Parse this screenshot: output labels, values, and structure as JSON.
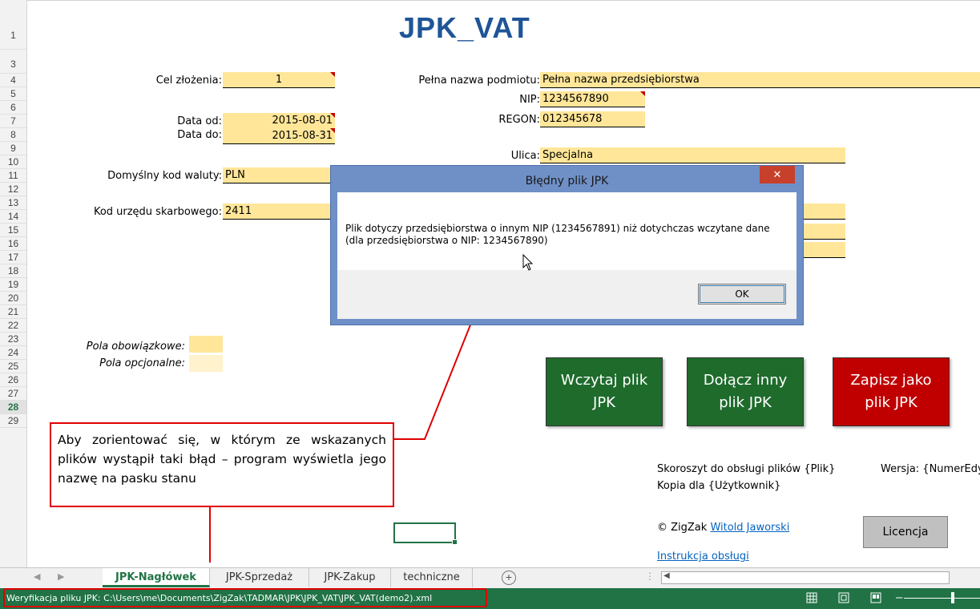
{
  "sheet": {
    "title": "JPK_VAT",
    "row_numbers": [
      "1",
      "3",
      "4",
      "5",
      "6",
      "7",
      "8",
      "9",
      "10",
      "11",
      "12",
      "13",
      "14",
      "15",
      "16",
      "17",
      "18",
      "19",
      "20",
      "21",
      "22",
      "23",
      "24",
      "25",
      "26",
      "27",
      "28",
      "29"
    ],
    "active_row": "28",
    "fields": {
      "cel_label": "Cel złożenia:",
      "cel_value": "1",
      "data_od_label": "Data od:",
      "data_od_value": "2015-08-01",
      "data_do_label": "Data do:",
      "data_do_value": "2015-08-31",
      "waluta_label": "Domyślny kod waluty:",
      "waluta_value": "PLN",
      "urzad_label": "Kod urzędu skarbowego:",
      "urzad_value": "2411",
      "nazwa_label": "Pełna nazwa podmiotu:",
      "nazwa_value": "Pełna nazwa przedsiębiorstwa",
      "nip_label": "NIP:",
      "nip_value": "1234567890",
      "regon_label": "REGON:",
      "regon_value": "012345678",
      "ulica_label": "Ulica:",
      "ulica_value": "Specjalna"
    },
    "legend": {
      "required": "Pola obowiązkowe:",
      "optional": "Pola opcjonalne:",
      "required_color": "#ffe699",
      "optional_color": "#fff2cc"
    },
    "buttons": {
      "load": "Wczytaj plik JPK",
      "append": "Dołącz inny plik JPK",
      "save": "Zapisz jako plik JPK",
      "license": "Licencja"
    },
    "info": {
      "workbook_line": "Skoroszyt do obsługi plików {Plik}",
      "version_line": "Wersja: {NumerEdycj",
      "copy_line": "Kopia dla {Użytkownik}",
      "copyright_prefix": "© ZigZak ",
      "author_link": "Witold Jaworski",
      "manual_link": "Instrukcja obsługi"
    },
    "callout": "Aby zorientować się, w którym ze wskazanych plików wystąpił taki błąd – program wyświetla jego nazwę na pasku stanu"
  },
  "dialog": {
    "title": "Błędny plik JPK",
    "close": "✕",
    "message": "Plik dotyczy przedsiębiorstwa o innym NIP (1234567891) niż dotychczas wczytane dane (dla przedsiębiorstwa o NIP: 1234567890)",
    "ok": "OK"
  },
  "tabs": {
    "items": [
      "JPK-Nagłówek",
      "JPK-Sprzedaż",
      "JPK-Zakup",
      "techniczne"
    ],
    "active": "JPK-Nagłówek",
    "add": "+"
  },
  "statusbar": {
    "text": "Weryfikacja pliku JPK: C:\\Users\\me\\Documents\\ZigZak\\TADMAR\\JPK\\JPK_VAT\\JPK_VAT(demo2).xml",
    "view_icons": [
      "normal-view-icon",
      "page-layout-icon",
      "page-break-icon"
    ],
    "accent": "#217346"
  },
  "colors": {
    "title": "#1f5597",
    "green_button": "#1e6b2c",
    "red_button": "#c00000",
    "callout_border": "#e00000"
  }
}
